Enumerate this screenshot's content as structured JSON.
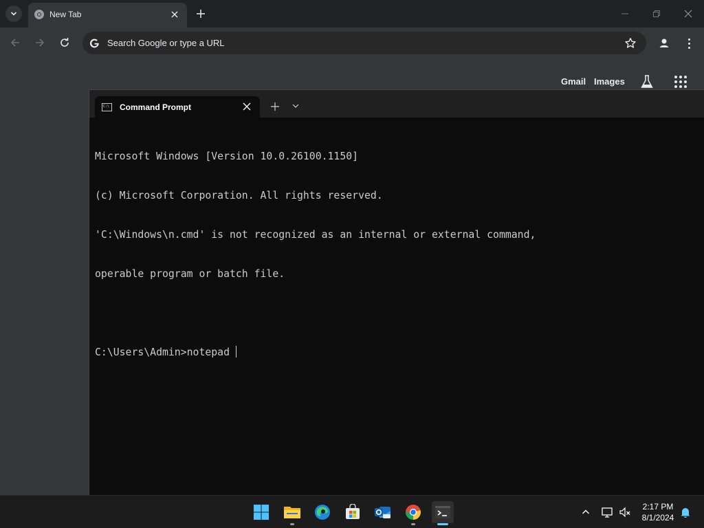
{
  "browser": {
    "tab_title": "New Tab",
    "omnibox_placeholder": "Search Google or type a URL",
    "ntp_links": [
      "Gmail",
      "Images"
    ]
  },
  "terminal": {
    "tab_title": "Command Prompt",
    "lines": [
      "Microsoft Windows [Version 10.0.26100.1150]",
      "(c) Microsoft Corporation. All rights reserved.",
      "'C:\\Windows\\n.cmd' is not recognized as an internal or external command,",
      "operable program or batch file.",
      "",
      "C:\\Users\\Admin>notepad"
    ]
  },
  "taskbar": {
    "apps": [
      "start-icon",
      "file-explorer-icon",
      "edge-icon",
      "store-icon",
      "outlook-icon",
      "chrome-icon",
      "terminal-icon"
    ],
    "time": "2:17 PM",
    "date": "8/1/2024"
  },
  "colors": {
    "chrome_frame": "#202124",
    "chrome_toolbar": "#35363a",
    "terminal_bg": "#0c0c0c",
    "accent": "#60cdff"
  }
}
